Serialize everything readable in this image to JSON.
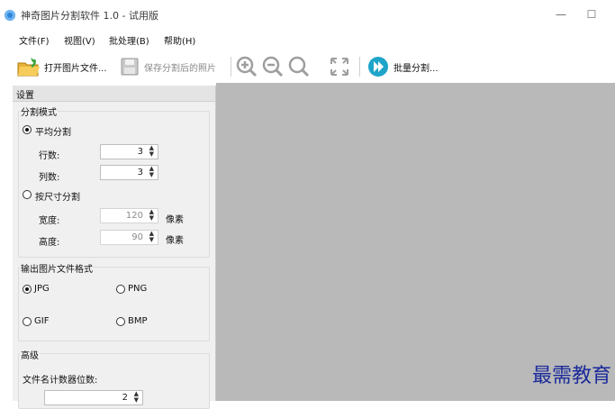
{
  "window": {
    "title": "神奇图片分割软件 1.0 - 试用版",
    "minimize": "—",
    "maximize": "☐"
  },
  "menu": [
    "文件(F)",
    "视图(V)",
    "批处理(B)",
    "帮助(H)"
  ],
  "toolbar": {
    "open_label": "打开图片文件...",
    "save_label": "保存分割后的照片",
    "batch_label": "批量分割..."
  },
  "settings": {
    "header": "设置",
    "split_mode": {
      "title": "分割模式",
      "average_label": "平均分割",
      "rows_label": "行数:",
      "rows_value": "3",
      "cols_label": "列数:",
      "cols_value": "3",
      "size_label": "按尺寸分割",
      "width_label": "宽度:",
      "width_value": "120",
      "height_label": "高度:",
      "height_value": "90",
      "unit": "像素"
    },
    "format": {
      "title": "输出图片文件格式",
      "jpg": "JPG",
      "png": "PNG",
      "gif": "GIF",
      "bmp": "BMP"
    },
    "advanced": {
      "title": "高级",
      "counter_label": "文件名计数器位数:",
      "counter_value": "2"
    }
  },
  "watermark": "最需教育"
}
